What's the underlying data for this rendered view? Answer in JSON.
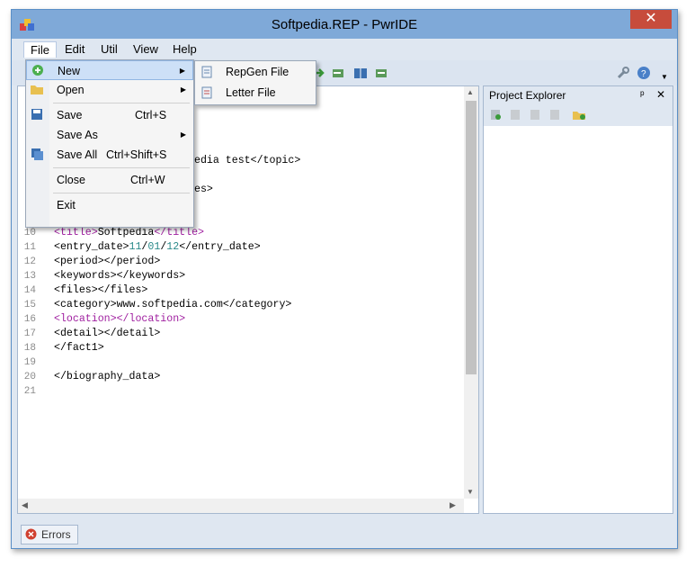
{
  "window": {
    "title": "Softpedia.REP - PwrIDE",
    "close_glyph": "✕"
  },
  "menubar": [
    {
      "label": "File"
    },
    {
      "label": "Edit"
    },
    {
      "label": "Util"
    },
    {
      "label": "View"
    },
    {
      "label": "Help"
    }
  ],
  "file_menu": {
    "new": "New",
    "open": "Open",
    "save": "Save",
    "save_shortcut": "Ctrl+S",
    "save_as": "Save As",
    "save_all": "Save All",
    "save_all_shortcut": "Ctrl+Shift+S",
    "close": "Close",
    "close_shortcut": "Ctrl+W",
    "exit": "Exit",
    "arrow": "▶"
  },
  "new_submenu": {
    "repgen": "RepGen File",
    "letter": "Letter File"
  },
  "editor": {
    "line_numbers": [
      "1",
      "2",
      "3",
      "4",
      "5",
      "6",
      "7",
      "8",
      "9",
      "10",
      "11",
      "12",
      "13",
      "14",
      "15",
      "16",
      "17",
      "18",
      "19",
      "20",
      "21"
    ],
    "visible_fragments": {
      "line4": "edia test</topic>",
      "line6": "es>"
    },
    "lines": {
      "l10": {
        "open": "<title>",
        "text": "Softpedia",
        "close": "</title>"
      },
      "l11": {
        "a": "<entry_date>",
        "n1": "11",
        "s1": "/",
        "n2": "01",
        "s2": "/",
        "n3": "12",
        "b": "</entry_date>"
      },
      "l12": "<period></period>",
      "l13": "<keywords></keywords>",
      "l14": "<files></files>",
      "l15": "<category>www.softpedia.com</category>",
      "l16": {
        "open": "<location>",
        "close": "</location>"
      },
      "l17": "<detail></detail>",
      "l18": "</fact1>",
      "l20": "</biography_data>"
    }
  },
  "project_explorer": {
    "title": "Project Explorer",
    "pin": "ᵖ",
    "close": "✕"
  },
  "statusbar": {
    "errors_tab": "Errors"
  },
  "colors": {
    "accent": "#7fa9d8",
    "tag": "#a020a0",
    "number": "#2b8a8a",
    "close": "#c74c3c"
  },
  "icons": [
    "app-icon",
    "new-icon",
    "open-folder-icon",
    "save-icon",
    "save-all-icon",
    "repgen-file-icon",
    "letter-file-icon",
    "wrench-icon",
    "help-icon",
    "error-icon"
  ]
}
